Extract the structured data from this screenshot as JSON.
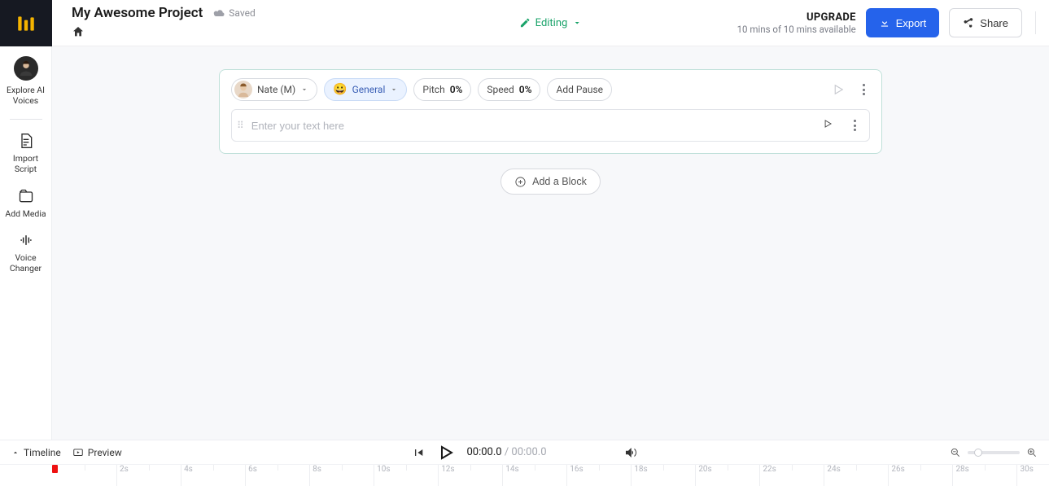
{
  "header": {
    "title": "My Awesome Project",
    "saved": "Saved",
    "mode": "Editing",
    "upgrade_title": "UPGRADE",
    "upgrade_sub": "10 mins of 10 mins available",
    "export": "Export",
    "share": "Share"
  },
  "sidebar": {
    "explore": "Explore AI Voices",
    "import": "Import Script",
    "add_media": "Add Media",
    "voice_changer": "Voice Changer"
  },
  "block": {
    "voice": "Nate (M)",
    "emotion": "General",
    "pitch_label": "Pitch",
    "pitch_val": "0%",
    "speed_label": "Speed",
    "speed_val": "0%",
    "add_pause": "Add Pause",
    "placeholder": "Enter your text here"
  },
  "add_block": "Add a Block",
  "bottom": {
    "timeline": "Timeline",
    "preview": "Preview",
    "time_current": "00:00.0",
    "time_total": "00:00.0"
  },
  "ruler_ticks": [
    "2s",
    "4s",
    "6s",
    "8s",
    "10s",
    "12s",
    "14s",
    "16s",
    "18s",
    "20s",
    "22s",
    "24s",
    "26s",
    "28s",
    "30s"
  ]
}
